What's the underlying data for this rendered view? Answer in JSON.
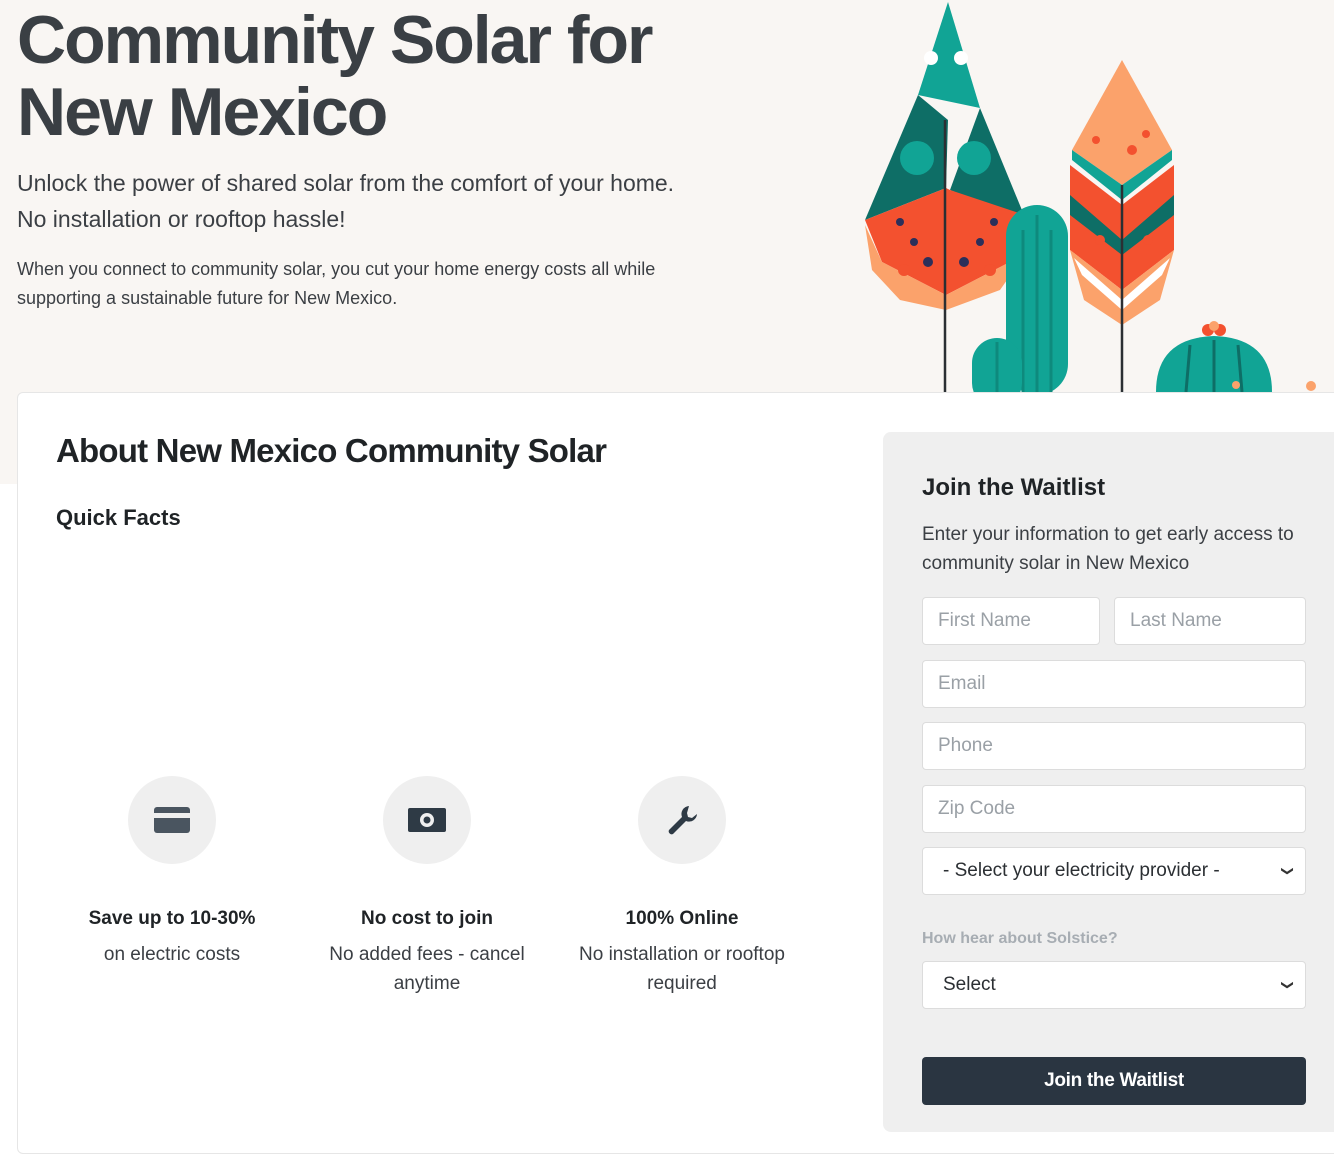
{
  "hero": {
    "title_line1": "Community Solar for",
    "title_line2": "New Mexico",
    "subtitle_line1": "Unlock the power of shared solar from the comfort of your home.",
    "subtitle_line2": "No installation or rooftop hassle!",
    "description_line1": "When you connect to community solar, you cut your home energy costs all while",
    "description_line2": "supporting a sustainable future for New Mexico."
  },
  "about": {
    "title": "About New Mexico Community Solar",
    "quick_facts_title": "Quick Facts",
    "facts": [
      {
        "icon": "credit-card-icon",
        "title": "Save up to 10-30%",
        "text": "on electric costs"
      },
      {
        "icon": "cash-icon",
        "title": "No cost to join",
        "text": "No added fees - cancel anytime"
      },
      {
        "icon": "wrench-icon",
        "title": "100% Online",
        "text": "No installation or rooftop required"
      }
    ]
  },
  "waitlist": {
    "title": "Join the Waitlist",
    "description": "Enter your information to get early access to community solar in New Mexico",
    "first_name_placeholder": "First Name",
    "last_name_placeholder": "Last Name",
    "email_placeholder": "Email",
    "phone_placeholder": "Phone",
    "zip_placeholder": "Zip Code",
    "provider_select": "- Select your electricity provider -",
    "hear_label": "How hear about Solstice?",
    "hear_select": "Select",
    "submit_label": "Join the Waitlist"
  },
  "colors": {
    "teal": "#11a495",
    "dark_teal": "#0e6e66",
    "orange_red": "#f3512f",
    "peach": "#fba26b",
    "button": "#2a3541"
  }
}
